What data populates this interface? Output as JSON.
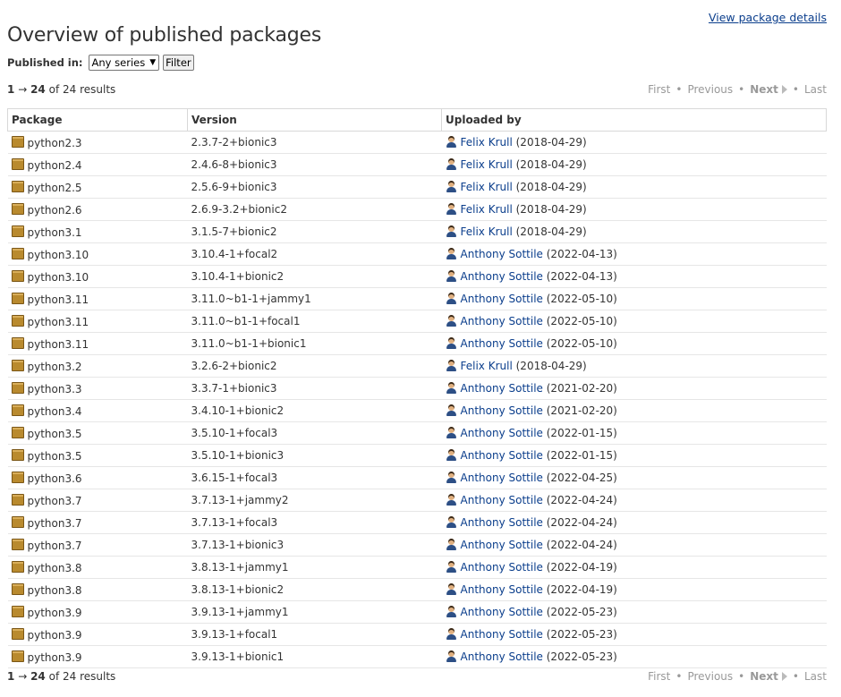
{
  "header": {
    "view_details_link": "View package details",
    "title": "Overview of published packages"
  },
  "filter": {
    "label": "Published in:",
    "series_selected": "Any series",
    "button": "Filter"
  },
  "results": {
    "range_start": "1",
    "arrow": "→",
    "range_end": "24",
    "suffix": "of 24 results"
  },
  "pager": {
    "first": "First",
    "previous": "Previous",
    "next": "Next",
    "last": "Last",
    "separator": "•"
  },
  "table": {
    "columns": [
      "Package",
      "Version",
      "Uploaded by"
    ],
    "rows": [
      {
        "package": "python2.3",
        "version": "2.3.7-2+bionic3",
        "uploader": "Felix Krull",
        "date": "(2018-04-29)"
      },
      {
        "package": "python2.4",
        "version": "2.4.6-8+bionic3",
        "uploader": "Felix Krull",
        "date": "(2018-04-29)"
      },
      {
        "package": "python2.5",
        "version": "2.5.6-9+bionic3",
        "uploader": "Felix Krull",
        "date": "(2018-04-29)"
      },
      {
        "package": "python2.6",
        "version": "2.6.9-3.2+bionic2",
        "uploader": "Felix Krull",
        "date": "(2018-04-29)"
      },
      {
        "package": "python3.1",
        "version": "3.1.5-7+bionic2",
        "uploader": "Felix Krull",
        "date": "(2018-04-29)"
      },
      {
        "package": "python3.10",
        "version": "3.10.4-1+focal2",
        "uploader": "Anthony Sottile",
        "date": "(2022-04-13)"
      },
      {
        "package": "python3.10",
        "version": "3.10.4-1+bionic2",
        "uploader": "Anthony Sottile",
        "date": "(2022-04-13)"
      },
      {
        "package": "python3.11",
        "version": "3.11.0~b1-1+jammy1",
        "uploader": "Anthony Sottile",
        "date": "(2022-05-10)"
      },
      {
        "package": "python3.11",
        "version": "3.11.0~b1-1+focal1",
        "uploader": "Anthony Sottile",
        "date": "(2022-05-10)"
      },
      {
        "package": "python3.11",
        "version": "3.11.0~b1-1+bionic1",
        "uploader": "Anthony Sottile",
        "date": "(2022-05-10)"
      },
      {
        "package": "python3.2",
        "version": "3.2.6-2+bionic2",
        "uploader": "Felix Krull",
        "date": "(2018-04-29)"
      },
      {
        "package": "python3.3",
        "version": "3.3.7-1+bionic3",
        "uploader": "Anthony Sottile",
        "date": "(2021-02-20)"
      },
      {
        "package": "python3.4",
        "version": "3.4.10-1+bionic2",
        "uploader": "Anthony Sottile",
        "date": "(2021-02-20)"
      },
      {
        "package": "python3.5",
        "version": "3.5.10-1+focal3",
        "uploader": "Anthony Sottile",
        "date": "(2022-01-15)"
      },
      {
        "package": "python3.5",
        "version": "3.5.10-1+bionic3",
        "uploader": "Anthony Sottile",
        "date": "(2022-01-15)"
      },
      {
        "package": "python3.6",
        "version": "3.6.15-1+focal3",
        "uploader": "Anthony Sottile",
        "date": "(2022-04-25)"
      },
      {
        "package": "python3.7",
        "version": "3.7.13-1+jammy2",
        "uploader": "Anthony Sottile",
        "date": "(2022-04-24)"
      },
      {
        "package": "python3.7",
        "version": "3.7.13-1+focal3",
        "uploader": "Anthony Sottile",
        "date": "(2022-04-24)"
      },
      {
        "package": "python3.7",
        "version": "3.7.13-1+bionic3",
        "uploader": "Anthony Sottile",
        "date": "(2022-04-24)"
      },
      {
        "package": "python3.8",
        "version": "3.8.13-1+jammy1",
        "uploader": "Anthony Sottile",
        "date": "(2022-04-19)"
      },
      {
        "package": "python3.8",
        "version": "3.8.13-1+bionic2",
        "uploader": "Anthony Sottile",
        "date": "(2022-04-19)"
      },
      {
        "package": "python3.9",
        "version": "3.9.13-1+jammy1",
        "uploader": "Anthony Sottile",
        "date": "(2022-05-23)"
      },
      {
        "package": "python3.9",
        "version": "3.9.13-1+focal1",
        "uploader": "Anthony Sottile",
        "date": "(2022-05-23)"
      },
      {
        "package": "python3.9",
        "version": "3.9.13-1+bionic1",
        "uploader": "Anthony Sottile",
        "date": "(2022-05-23)"
      }
    ]
  },
  "icons": {
    "package": "package-icon",
    "uploader": "person-icon",
    "next": "next-arrow-icon"
  },
  "colors": {
    "link": "#0b3e8c",
    "disabled": "#999999",
    "package_icon": "#b98a2e"
  }
}
